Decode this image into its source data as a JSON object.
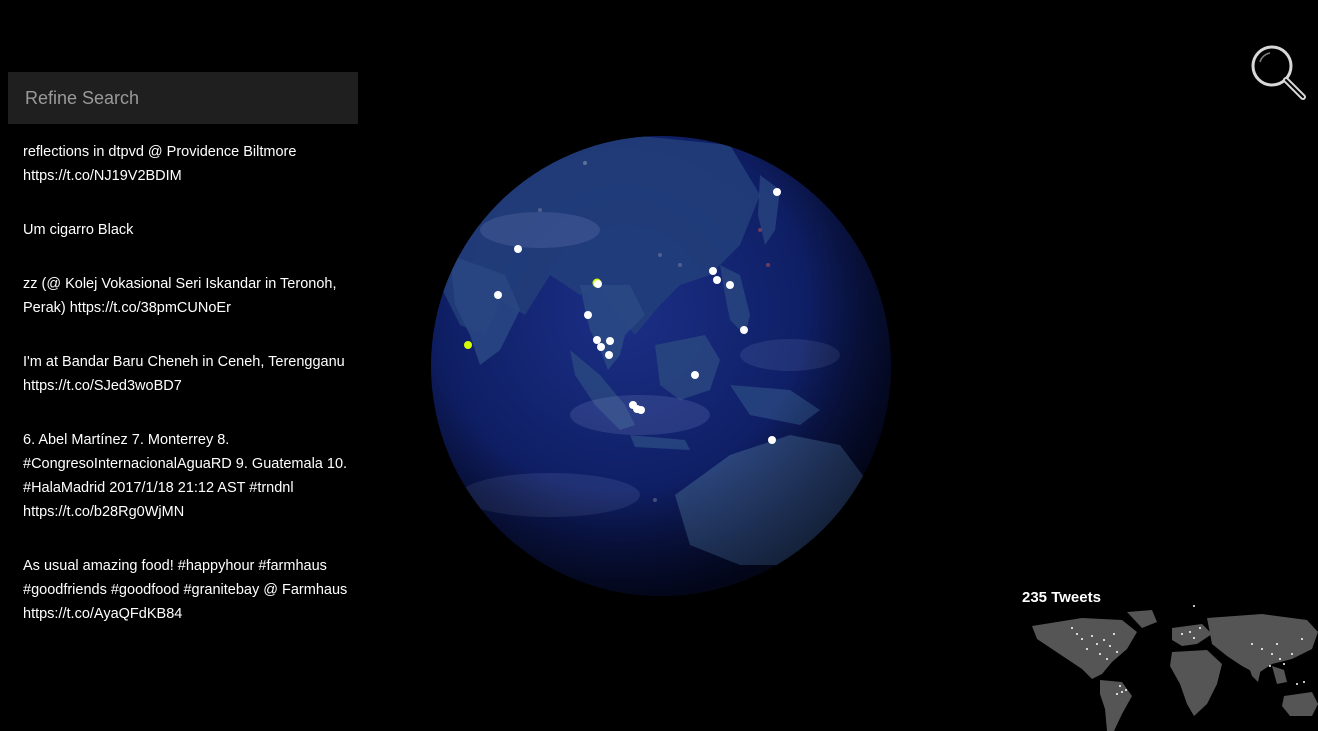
{
  "search": {
    "placeholder": "Refine Search"
  },
  "tweets": [
    "reflections in dtpvd @ Providence Biltmore https://t.co/NJ19V2BDIM",
    "Um cigarro Black",
    "zz (@ Kolej Vokasional Seri Iskandar in Teronoh, Perak) https://t.co/38pmCUNoEr",
    "I'm at Bandar Baru Cheneh in Ceneh, Terengganu https://t.co/SJed3woBD7",
    "6. Abel Martínez  7. Monterrey  8. #CongresoInternacionalAguaRD  9. Guatemala 10. #HalaMadrid 2017/1/18 21:12 AST #trndnl https://t.co/b28Rg0WjMN",
    "As usual amazing food! #happyhour #farmhaus #goodfriends #goodfood #granitebay @ Farmhaus https://t.co/AyaQFdKB84"
  ],
  "stats": {
    "tweet_count_label": "235 Tweets"
  },
  "icons": {
    "search": "magnifier-icon"
  },
  "colors": {
    "background": "#000000",
    "ocean": "#0d1a5c",
    "land": "#1e3a6b",
    "tweet_marker": "#ffffff",
    "highlight_marker": "#d4ff00",
    "mini_map_land": "#555555"
  }
}
